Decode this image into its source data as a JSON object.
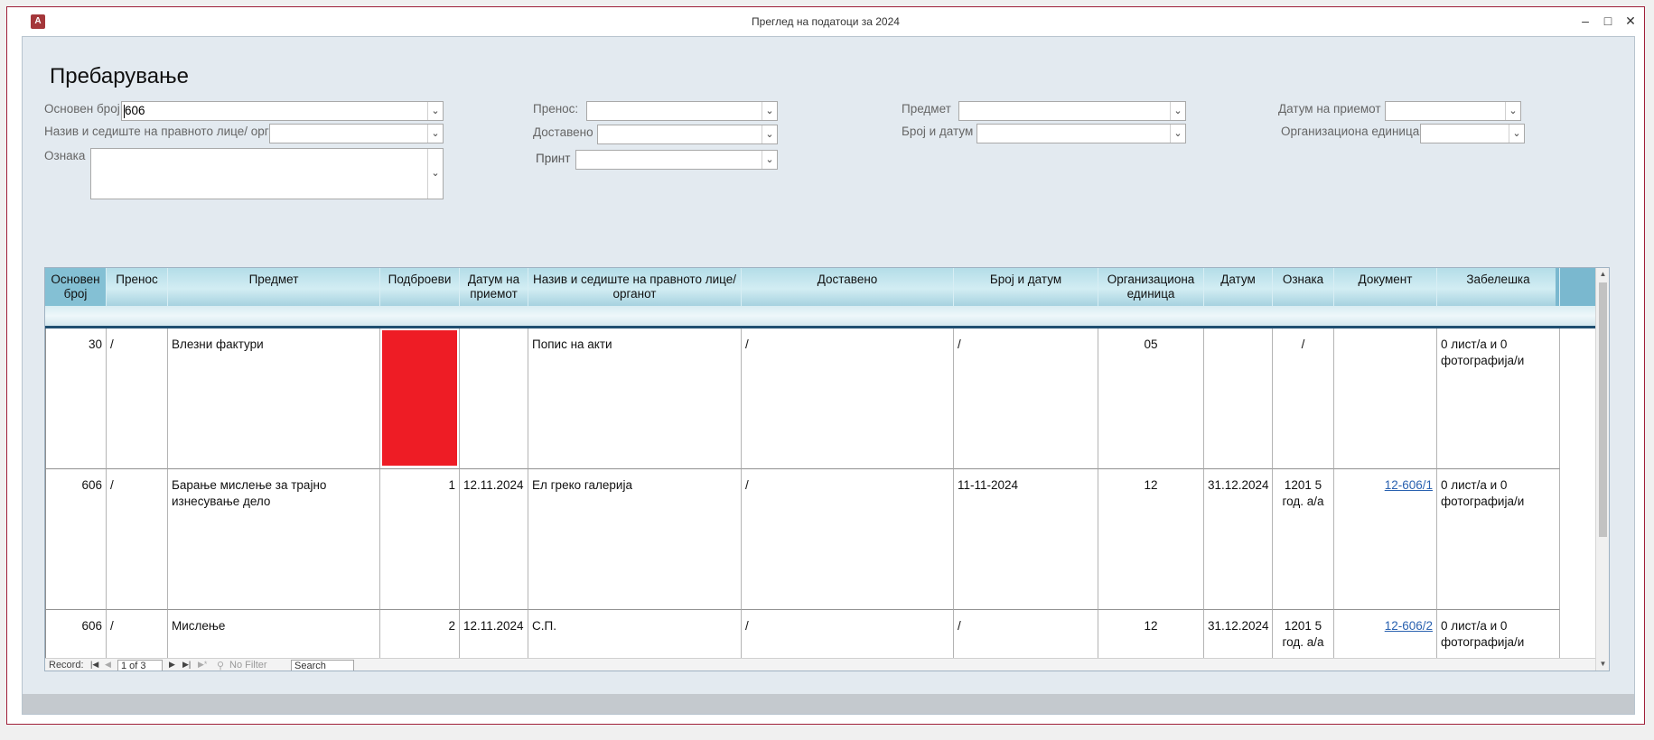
{
  "window": {
    "title": "Преглед на податоци за 2024",
    "app_icon": "A",
    "minimize": "–",
    "maximize": "□",
    "close": "✕"
  },
  "form": {
    "heading": "Пребарување",
    "fields": {
      "osnoven_broj": {
        "label": "Основен број",
        "value": "606"
      },
      "naziv": {
        "label": "Назив и седиште на правното лице/ органот",
        "value": ""
      },
      "oznaka": {
        "label": "Ознака",
        "value": ""
      },
      "prenos": {
        "label": "Пренос:",
        "value": ""
      },
      "dostaveno": {
        "label": "Доставено",
        "value": ""
      },
      "print": {
        "label": "Принт",
        "value": ""
      },
      "predmet": {
        "label": "Предмет",
        "value": ""
      },
      "broj_datum": {
        "label": "Број и датум",
        "value": ""
      },
      "datum_priem": {
        "label": "Датум на приемот",
        "value": ""
      },
      "org_edinica": {
        "label": "Организациона единица",
        "value": ""
      }
    }
  },
  "grid": {
    "columns": [
      "Основен број",
      "Пренос",
      "Предмет",
      "Подброеви",
      "Датум на приемот",
      "Назив и седиште на правното лице/ органот",
      "Доставено",
      "Број и датум",
      "Организациона единица",
      "Датум",
      "Ознака",
      "Документ",
      "Забелешка"
    ],
    "rows": [
      {
        "osnoven_broj": "30",
        "prenos": "/",
        "predmet": "Влезни фактури",
        "podbroevi": "",
        "datum_priem": "",
        "naziv": "Попис на акти",
        "dostaveno": "/",
        "broj_datum": "/",
        "org": "05",
        "datum": "",
        "oznaka": "/",
        "dokument": "",
        "zabeleska": "0 лист/а и 0 фотографија/и",
        "highlight_color": "#ee1c25"
      },
      {
        "osnoven_broj": "606",
        "prenos": "/",
        "predmet": "Барање мислење за трајно изнесување дело",
        "podbroevi": "1",
        "datum_priem": "12.11.2024",
        "naziv": "Ел греко галерија",
        "dostaveno": "/",
        "broj_datum": "11-11-2024",
        "org": "12",
        "datum": "31.12.2024",
        "oznaka": "1201 5 год. а/а",
        "dokument": "12-606/1",
        "zabeleska": "0 лист/а и 0 фотографија/и"
      },
      {
        "osnoven_broj": "606",
        "prenos": "/",
        "predmet": "Мислење",
        "podbroevi": "2",
        "datum_priem": "12.11.2024",
        "naziv": "С.П.",
        "dostaveno": "/",
        "broj_datum": "/",
        "org": "12",
        "datum": "31.12.2024",
        "oznaka": "1201 5 год. а/а",
        "dokument": "12-606/2",
        "zabeleska": "0 лист/а и 0 фотографија/и"
      }
    ]
  },
  "navigation": {
    "record_label": "Record:",
    "first": "|◀",
    "prev": "◀",
    "position": "1 of 3",
    "next": "▶",
    "last": "▶|",
    "new": "▶*",
    "filter": "No Filter",
    "search_placeholder": "Search"
  },
  "colors": {
    "header_gradient_top": "#b4dde8",
    "highlight_red": "#ee1c25",
    "link_blue": "#2a62b0",
    "form_bg": "#e3eaf0"
  }
}
